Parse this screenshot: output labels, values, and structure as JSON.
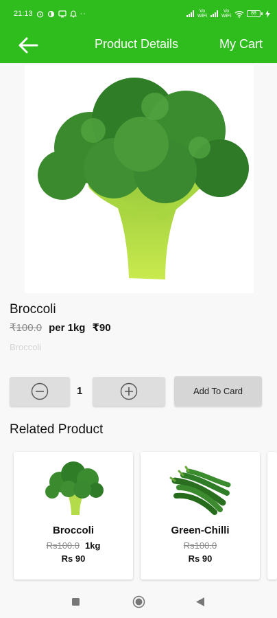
{
  "status_bar": {
    "time": "21:13",
    "network_label": "Vo WiFi",
    "battery": "88"
  },
  "app_bar": {
    "title": "Product Details",
    "cart_label": "My Cart",
    "icons": {
      "back": "back-arrow-icon"
    }
  },
  "product": {
    "name": "Broccoli",
    "old_price": "₹100.0",
    "unit": "per 1kg",
    "price": "₹90",
    "category": "Broccoli",
    "image_icon": "broccoli-image"
  },
  "cart_controls": {
    "quantity": "1",
    "add_label": "Add To Card",
    "icons": {
      "decrease": "minus-circle-icon",
      "increase": "plus-circle-icon"
    }
  },
  "related": {
    "title": "Related Product",
    "items": [
      {
        "name": "Broccoli",
        "old_price": "Rs100.0",
        "unit": "1kg",
        "price": "Rs 90",
        "image_icon": "broccoli-image"
      },
      {
        "name": "Green-Chilli",
        "old_price": "Rs100.0",
        "unit": "",
        "price": "Rs 90",
        "image_icon": "green-chilli-image"
      }
    ]
  },
  "system_nav": {
    "icons": [
      "recents-square-icon",
      "home-circle-icon",
      "back-triangle-icon"
    ]
  },
  "colors": {
    "primary": "#2fbd1e",
    "button_gray": "#dedede",
    "muted": "#888888"
  }
}
